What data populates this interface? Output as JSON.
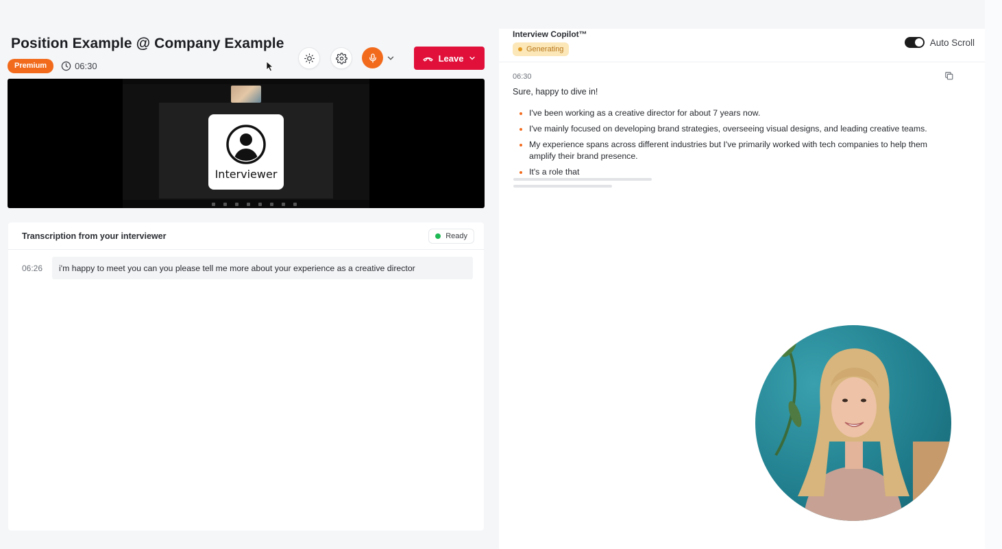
{
  "header": {
    "title": "Position Example @ Company Example",
    "plan_badge": "Premium",
    "elapsed_time": "06:30",
    "leave_label": "Leave"
  },
  "video": {
    "participant_label": "Interviewer"
  },
  "transcript": {
    "title": "Transcription from your interviewer",
    "status": "Ready",
    "entries": [
      {
        "time": "06:26",
        "text": "i'm happy to meet you can you please tell me more about your experience as a creative director"
      }
    ]
  },
  "copilot": {
    "title": "Interview Copilot™",
    "status": "Generating",
    "auto_scroll_label": "Auto Scroll",
    "auto_scroll_on": true,
    "answer": {
      "time": "06:30",
      "lead": "Sure, happy to dive in!",
      "bullets": [
        "I've been working as a creative director for about 7 years now.",
        "I've mainly focused on developing brand strategies, overseeing visual designs, and leading creative teams.",
        "My experience spans across different industries but I've primarily worked with tech companies to help them amplify their brand presence.",
        "It's a role that"
      ]
    }
  },
  "colors": {
    "accent_orange": "#f26b1d",
    "leave_red": "#e0103a",
    "ready_green": "#1db954",
    "generating_bg": "#fbe7b8"
  },
  "icons": {
    "theme": "sun-icon",
    "settings": "gear-icon",
    "mic": "microphone-icon",
    "leave": "phone-hangup-icon",
    "timer": "clock-icon",
    "copy": "copy-icon"
  }
}
